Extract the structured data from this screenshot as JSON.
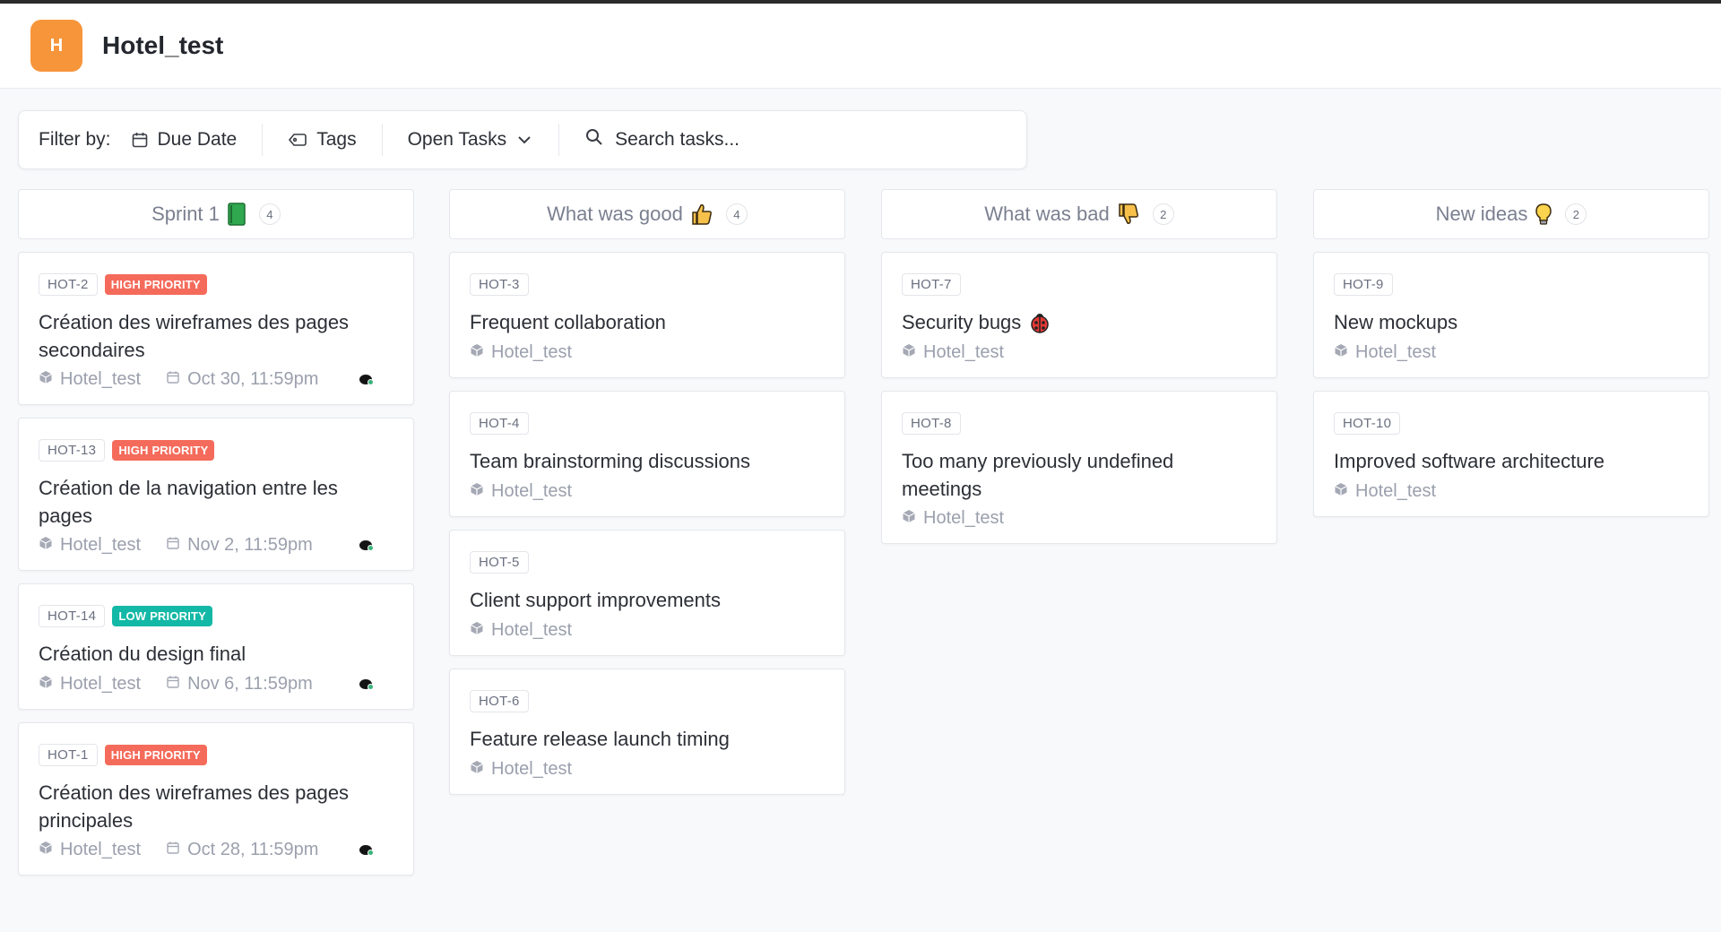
{
  "project": {
    "logo_letter": "H",
    "title": "Hotel_test"
  },
  "filters": {
    "label": "Filter by:",
    "due_date": "Due Date",
    "tags": "Tags",
    "status": "Open Tasks",
    "search_placeholder": "Search tasks..."
  },
  "columns": [
    {
      "title": "Sprint 1",
      "emoji": "green-book",
      "count": "4",
      "cards": [
        {
          "id": "HOT-2",
          "priority": "HIGH PRIORITY",
          "priority_level": "high",
          "title": "Création des wireframes des pages secondaires",
          "project": "Hotel_test",
          "due": "Oct 30, 11:59pm"
        },
        {
          "id": "HOT-13",
          "priority": "HIGH PRIORITY",
          "priority_level": "high",
          "title": "Création de la navigation entre les pages",
          "project": "Hotel_test",
          "due": "Nov 2, 11:59pm"
        },
        {
          "id": "HOT-14",
          "priority": "LOW PRIORITY",
          "priority_level": "low",
          "title": "Création du design final",
          "project": "Hotel_test",
          "due": "Nov 6, 11:59pm"
        },
        {
          "id": "HOT-1",
          "priority": "HIGH PRIORITY",
          "priority_level": "high",
          "title": "Création des wireframes des pages principales",
          "project": "Hotel_test",
          "due": "Oct 28, 11:59pm"
        }
      ]
    },
    {
      "title": "What was good",
      "emoji": "thumbs-up",
      "count": "4",
      "cards": [
        {
          "id": "HOT-3",
          "title": "Frequent collaboration",
          "project": "Hotel_test"
        },
        {
          "id": "HOT-4",
          "title": "Team brainstorming discussions",
          "project": "Hotel_test"
        },
        {
          "id": "HOT-5",
          "title": "Client support improvements",
          "project": "Hotel_test"
        },
        {
          "id": "HOT-6",
          "title": "Feature release launch timing",
          "project": "Hotel_test"
        }
      ]
    },
    {
      "title": "What was bad",
      "emoji": "thumbs-down",
      "count": "2",
      "cards": [
        {
          "id": "HOT-7",
          "title": "Security bugs",
          "title_emoji": "ladybug",
          "project": "Hotel_test"
        },
        {
          "id": "HOT-8",
          "title": "Too many previously undefined meetings",
          "project": "Hotel_test"
        }
      ]
    },
    {
      "title": "New ideas",
      "emoji": "light-bulb",
      "count": "2",
      "cards": [
        {
          "id": "HOT-9",
          "title": "New mockups",
          "project": "Hotel_test"
        },
        {
          "id": "HOT-10",
          "title": "Improved software architecture",
          "project": "Hotel_test"
        }
      ]
    }
  ],
  "colors": {
    "logo": "#f7953a",
    "high_priority": "#f56b5b",
    "low_priority": "#14b8a6",
    "background": "#f8f9fb"
  }
}
